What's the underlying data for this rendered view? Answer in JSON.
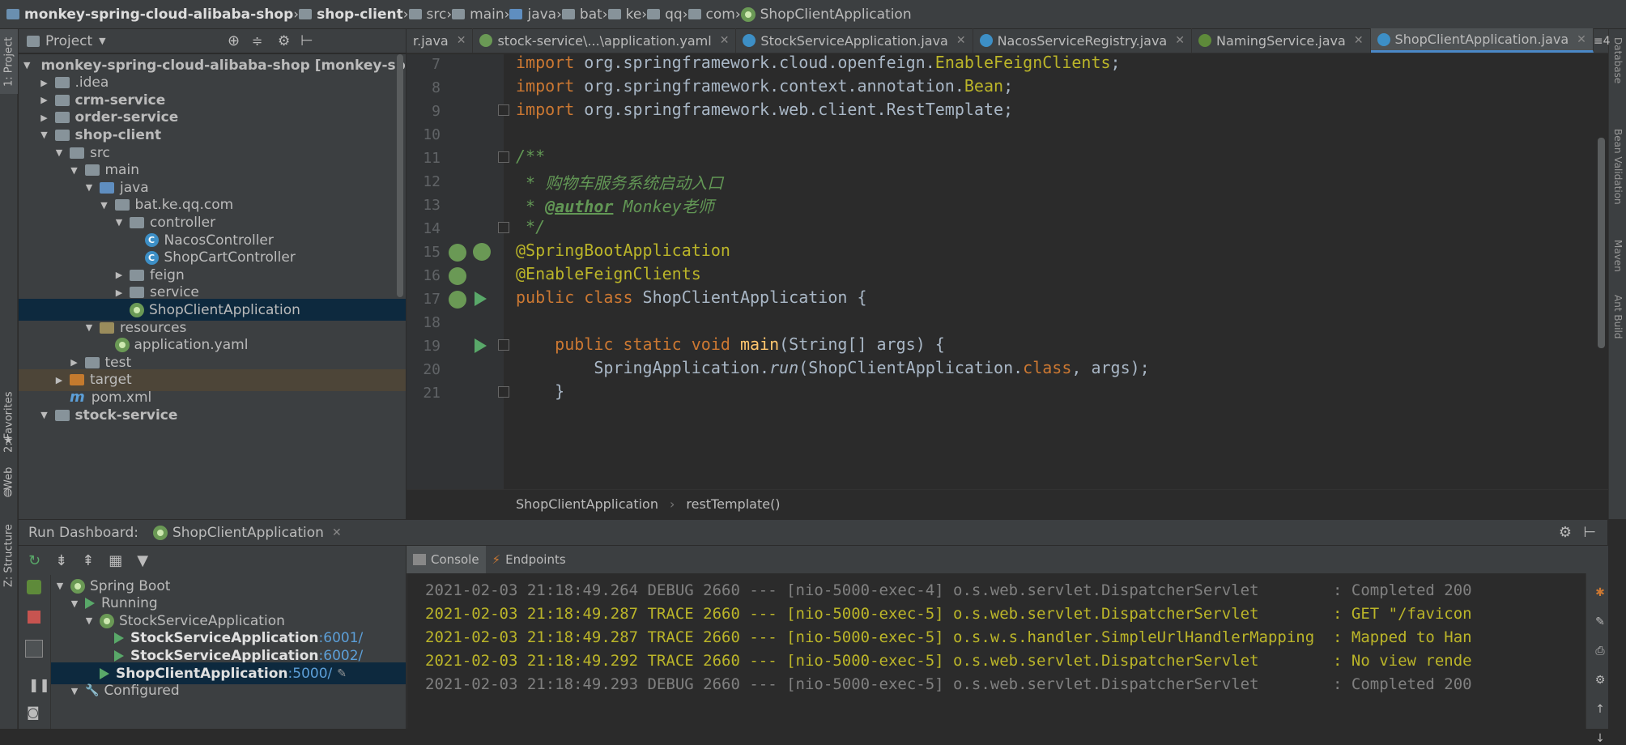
{
  "breadcrumb": [
    "monkey-spring-cloud-alibaba-shop",
    "shop-client",
    "src",
    "main",
    "java",
    "bat",
    "ke",
    "qq",
    "com",
    "ShopClientApplication"
  ],
  "tool_strip": {
    "project": "1: Project",
    "favorites": "2: Favorites",
    "web": "Web",
    "structure": "Z: Structure"
  },
  "right_strip": {
    "database": "Database",
    "bean": "Bean Validation",
    "maven": "Maven",
    "ant": "Ant Build"
  },
  "project_panel": {
    "title": "Project",
    "tree": [
      {
        "text": "monkey-spring-cloud-alibaba-shop",
        "suffix": "[monkey-spring-cl",
        "level": 0,
        "arrow": "▼",
        "icon": "folder",
        "bold": true
      },
      {
        "text": ".idea",
        "level": 1,
        "arrow": "▶",
        "icon": "folder"
      },
      {
        "text": "crm-service",
        "level": 1,
        "arrow": "▶",
        "icon": "folder",
        "bold": true
      },
      {
        "text": "order-service",
        "level": 1,
        "arrow": "▶",
        "icon": "folder",
        "bold": true
      },
      {
        "text": "shop-client",
        "level": 1,
        "arrow": "▼",
        "icon": "folder",
        "bold": true
      },
      {
        "text": "src",
        "level": 2,
        "arrow": "▼",
        "icon": "folder"
      },
      {
        "text": "main",
        "level": 3,
        "arrow": "▼",
        "icon": "folder"
      },
      {
        "text": "java",
        "level": 4,
        "arrow": "▼",
        "icon": "folder-blue"
      },
      {
        "text": "bat.ke.qq.com",
        "level": 5,
        "arrow": "▼",
        "icon": "folder"
      },
      {
        "text": "controller",
        "level": 6,
        "arrow": "▼",
        "icon": "folder"
      },
      {
        "text": "NacosController",
        "level": 7,
        "arrow": "",
        "icon": "class"
      },
      {
        "text": "ShopCartController",
        "level": 7,
        "arrow": "",
        "icon": "class"
      },
      {
        "text": "feign",
        "level": 6,
        "arrow": "▶",
        "icon": "folder"
      },
      {
        "text": "service",
        "level": 6,
        "arrow": "▶",
        "icon": "folder"
      },
      {
        "text": "ShopClientApplication",
        "level": 6,
        "arrow": "",
        "icon": "spring-class",
        "selected": true
      },
      {
        "text": "resources",
        "level": 4,
        "arrow": "▼",
        "icon": "folder-res"
      },
      {
        "text": "application.yaml",
        "level": 5,
        "arrow": "",
        "icon": "yaml"
      },
      {
        "text": "test",
        "level": 3,
        "arrow": "▶",
        "icon": "folder"
      },
      {
        "text": "target",
        "level": 2,
        "arrow": "▶",
        "icon": "folder-orange",
        "excluded": true
      },
      {
        "text": "pom.xml",
        "level": 2,
        "arrow": "",
        "icon": "maven"
      },
      {
        "text": "stock-service",
        "level": 1,
        "arrow": "▼",
        "icon": "folder",
        "bold": true
      }
    ]
  },
  "tabs": [
    {
      "label": "r.java",
      "icon": "none",
      "active": false
    },
    {
      "label": "stock-service\\...\\application.yaml",
      "icon": "yaml",
      "active": false
    },
    {
      "label": "StockServiceApplication.java",
      "icon": "class",
      "active": false
    },
    {
      "label": "NacosServiceRegistry.java",
      "icon": "class",
      "active": false
    },
    {
      "label": "NamingService.java",
      "icon": "interface",
      "active": false
    },
    {
      "label": "ShopClientApplication.java",
      "icon": "class",
      "active": true
    }
  ],
  "tabs_overflow": "≡4",
  "editor": {
    "lines": [
      {
        "n": "7",
        "html": "<span class='kw'>import</span> org.springframework.cloud.openfeign.<span class='ann'>EnableFeignClients</span>;"
      },
      {
        "n": "8",
        "html": "<span class='kw'>import</span> org.springframework.context.annotation.<span class='ann'>Bean</span>;"
      },
      {
        "n": "9",
        "html": "<span class='kw'>import</span> org.springframework.web.client.RestTemplate;"
      },
      {
        "n": "10",
        "html": ""
      },
      {
        "n": "11",
        "html": "<span class='cmt'>/**</span>"
      },
      {
        "n": "12",
        "html": "<span class='cmt'> * 购物车服务系统启动入口</span>"
      },
      {
        "n": "13",
        "html": "<span class='cmt'> * </span><span class='tag'>@author</span><span class='cmt'> Monkey老师</span>"
      },
      {
        "n": "14",
        "html": "<span class='cmt'> */</span>"
      },
      {
        "n": "15",
        "html": "<span class='ann'>@SpringBootApplication</span>"
      },
      {
        "n": "16",
        "html": "<span class='ann'>@EnableFeignClients</span>"
      },
      {
        "n": "17",
        "html": "<span class='kw'>public class</span> ShopClientApplication {"
      },
      {
        "n": "18",
        "html": ""
      },
      {
        "n": "19",
        "html": "    <span class='kw'>public static void</span> <span class='fn'>main</span>(String[] args) {"
      },
      {
        "n": "20",
        "html": "        SpringApplication.<span class='it'>run</span>(ShopClientApplication.<span class='kw'>class</span>, args);"
      },
      {
        "n": "21",
        "html": "    }"
      }
    ],
    "breadcrumb": [
      "ShopClientApplication",
      "restTemplate()"
    ]
  },
  "run_dashboard": {
    "label": "Run Dashboard:",
    "tab": "ShopClientApplication",
    "tree": [
      {
        "text": "Spring Boot",
        "level": 0,
        "arrow": "▼",
        "icon": "spring"
      },
      {
        "text": "Running",
        "level": 1,
        "arrow": "▼",
        "icon": "play"
      },
      {
        "text": "StockServiceApplication",
        "level": 2,
        "arrow": "▼",
        "icon": "spring"
      },
      {
        "text": "StockServiceApplication",
        "port": ":6001/",
        "level": 3,
        "arrow": "",
        "icon": "play",
        "bold": true
      },
      {
        "text": "StockServiceApplication",
        "port": ":6002/",
        "level": 3,
        "arrow": "",
        "icon": "play",
        "bold": true
      },
      {
        "text": "ShopClientApplication",
        "port": ":5000/",
        "level": 2,
        "arrow": "",
        "icon": "play",
        "bold": true,
        "selected": true
      },
      {
        "text": "Configured",
        "level": 1,
        "arrow": "▼",
        "icon": "wrench"
      }
    ]
  },
  "console": {
    "tabs": [
      "Console",
      "Endpoints"
    ],
    "lines": [
      {
        "text": "2021-02-03 21:18:49.264 DEBUG 2660 --- [nio-5000-exec-4] o.s.web.servlet.DispatcherServlet        : Completed 200",
        "level": "debug"
      },
      {
        "text": "2021-02-03 21:18:49.287 TRACE 2660 --- [nio-5000-exec-5] o.s.web.servlet.DispatcherServlet        : GET \"/favicon",
        "level": "trace"
      },
      {
        "text": "2021-02-03 21:18:49.287 TRACE 2660 --- [nio-5000-exec-5] o.s.w.s.handler.SimpleUrlHandlerMapping  : Mapped to Han",
        "level": "trace"
      },
      {
        "text": "2021-02-03 21:18:49.292 TRACE 2660 --- [nio-5000-exec-5] o.s.web.servlet.DispatcherServlet        : No view rende",
        "level": "trace"
      },
      {
        "text": "2021-02-03 21:18:49.293 DEBUG 2660 --- [nio-5000-exec-5] o.s.web.servlet.DispatcherServlet        : Completed 200",
        "level": "debug"
      }
    ]
  }
}
